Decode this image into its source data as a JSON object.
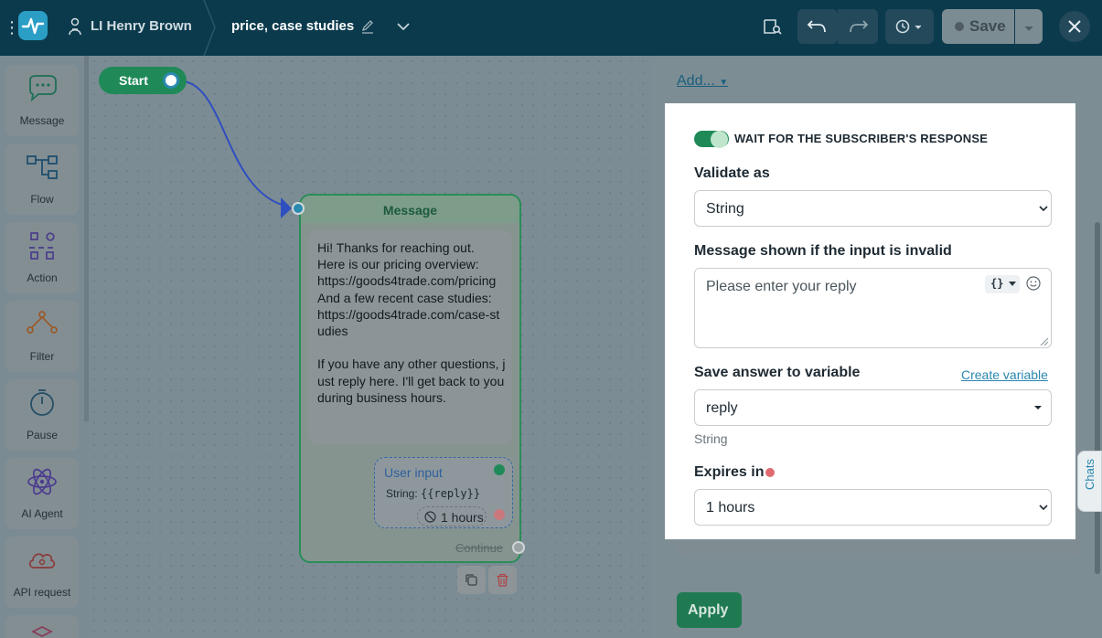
{
  "topbar": {
    "bot_name": "LI Henry Brown",
    "flow_name": "price, case studies",
    "save_label": "Save"
  },
  "sidebar": {
    "items": [
      {
        "label": "Message",
        "icon": "chat-bubble-icon"
      },
      {
        "label": "Flow",
        "icon": "flow-icon"
      },
      {
        "label": "Action",
        "icon": "action-icon"
      },
      {
        "label": "Filter",
        "icon": "filter-icon"
      },
      {
        "label": "Pause",
        "icon": "timer-icon"
      },
      {
        "label": "AI Agent",
        "icon": "atom-icon"
      },
      {
        "label": "API request",
        "icon": "cloud-icon"
      }
    ]
  },
  "canvas": {
    "start_label": "Start",
    "message_node": {
      "title": "Message",
      "text": "Hi! Thanks for reaching out.\nHere is our pricing overview:\nhttps://goods4trade.com/pricing\nAnd a few recent case studies:\nhttps://goods4trade.com/case-studies\n\nIf you have any other questions, just reply here. I'll get back to you during business hours.",
      "user_input_title": "User input",
      "user_input_type": "String: ",
      "user_input_var": "{{reply}}",
      "hours_label": "1 hours",
      "continue_label": "Continue"
    }
  },
  "panel": {
    "add_label": "Add...",
    "apply_label": "Apply",
    "chats_label": "Chats",
    "toggle_label": "WAIT FOR THE SUBSCRIBER'S RESPONSE",
    "validate_label": "Validate as",
    "validate_value": "String",
    "invalid_msg_label": "Message shown if the input is invalid",
    "invalid_msg_placeholder": "Please enter your reply",
    "variable_btn": "{}",
    "save_var_label": "Save answer to variable",
    "create_var_link": "Create variable",
    "save_var_value": "reply",
    "save_var_type": "String",
    "expires_label": "Expires in",
    "expires_value": "1 hours"
  },
  "colors": {
    "topbar_bg": "#0b3a4d",
    "accent_green": "#1f8a58",
    "accent_blue": "#2a87b0",
    "required_dot": "#e06a6f"
  }
}
